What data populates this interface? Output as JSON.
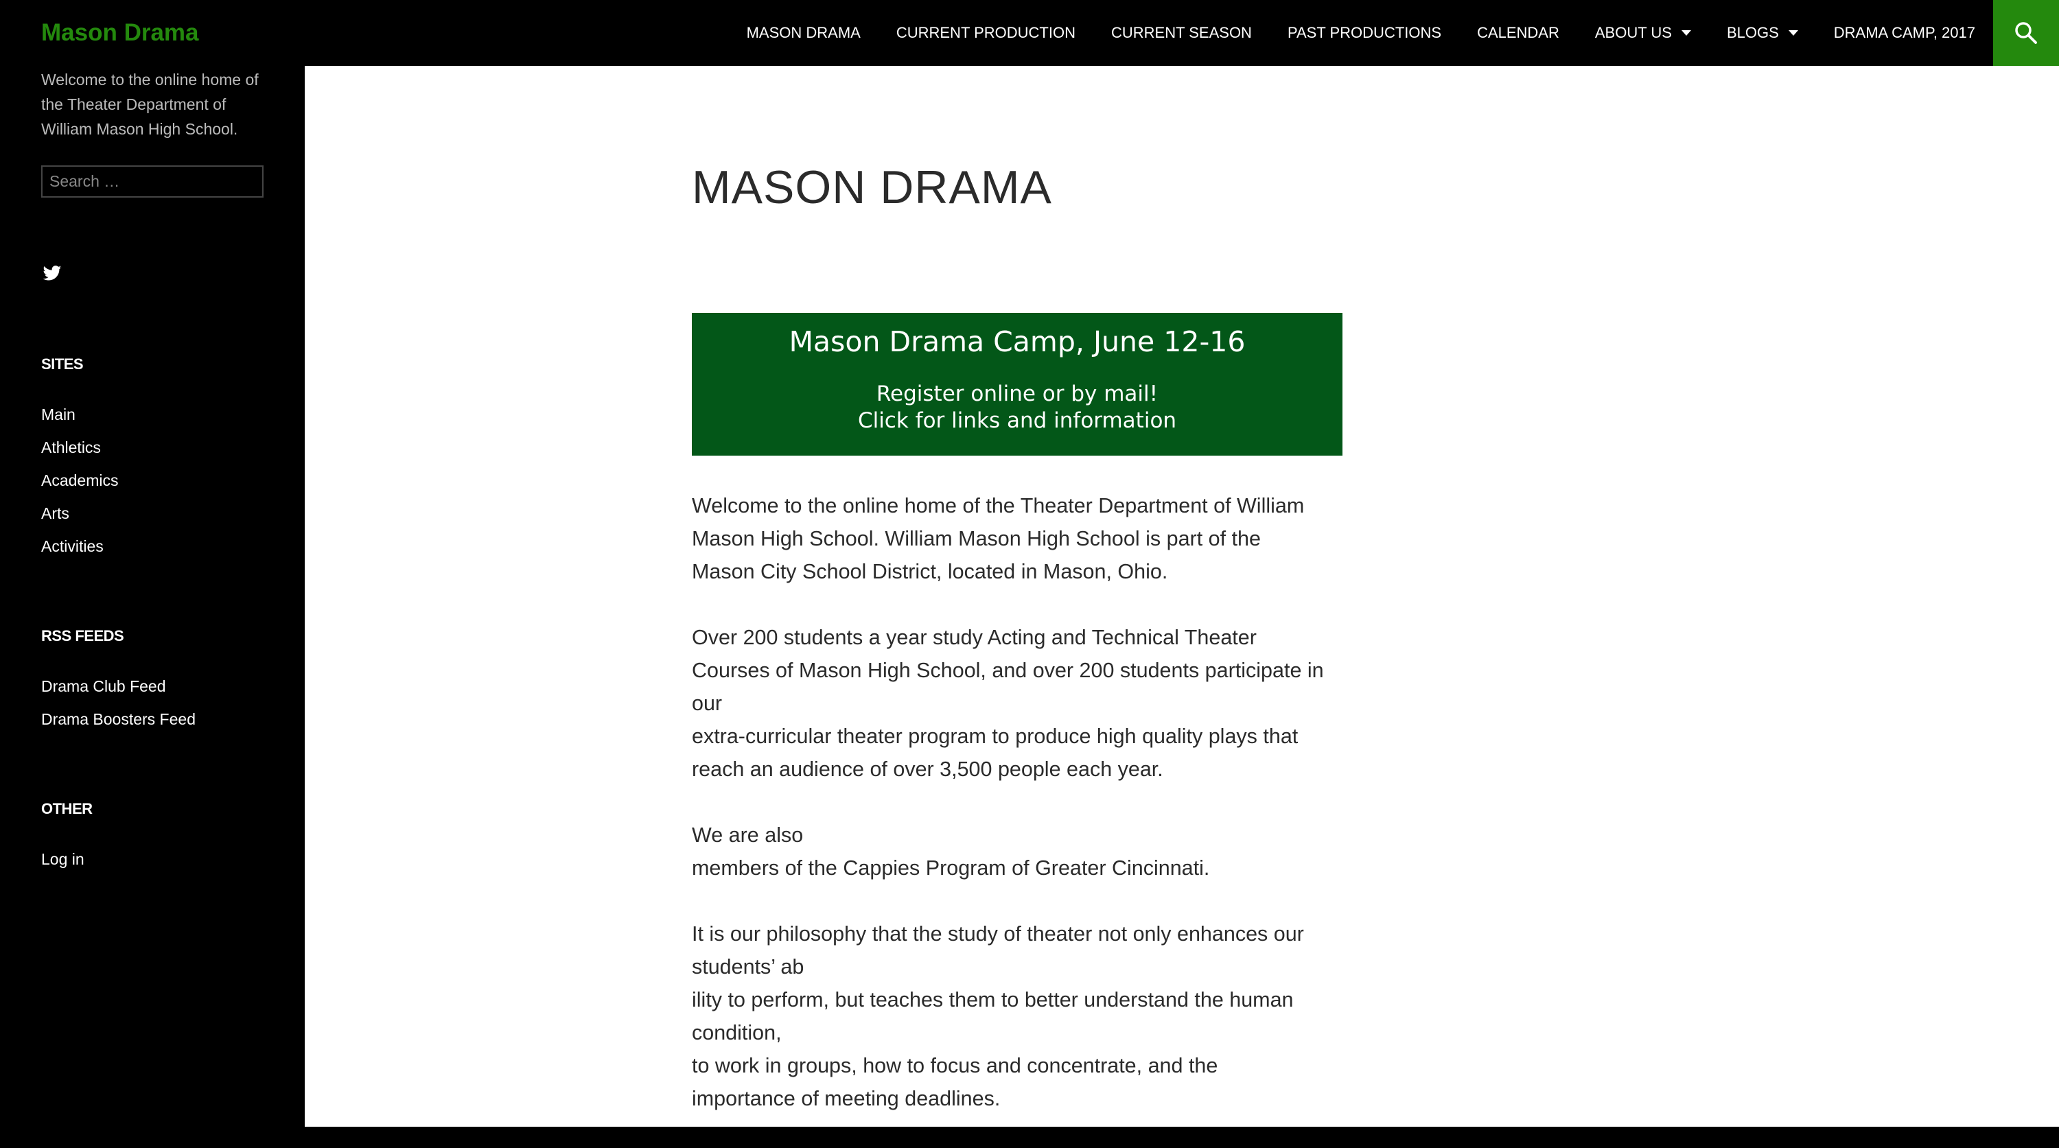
{
  "header": {
    "site_title": "Mason Drama",
    "nav": [
      {
        "label": "MASON DRAMA",
        "active": true,
        "dropdown": false
      },
      {
        "label": "CURRENT PRODUCTION",
        "active": false,
        "dropdown": false
      },
      {
        "label": "CURRENT SEASON",
        "active": false,
        "dropdown": false
      },
      {
        "label": "PAST PRODUCTIONS",
        "active": false,
        "dropdown": false
      },
      {
        "label": "CALENDAR",
        "active": false,
        "dropdown": false
      },
      {
        "label": "ABOUT US",
        "active": false,
        "dropdown": true
      },
      {
        "label": "BLOGS",
        "active": false,
        "dropdown": true
      },
      {
        "label": "DRAMA CAMP, 2017",
        "active": false,
        "dropdown": false
      }
    ],
    "search_icon": "search-icon"
  },
  "sidebar": {
    "description": "Welcome to the online home of the Theater Department of William Mason High School.",
    "search_placeholder": "Search …",
    "social_icon": "twitter-icon",
    "sites": {
      "title": "SITES",
      "items": [
        "Main",
        "Athletics",
        "Academics",
        "Arts",
        "Activities"
      ]
    },
    "rss": {
      "title": "RSS FEEDS",
      "items": [
        "Drama Club Feed",
        "Drama Boosters Feed"
      ]
    },
    "other": {
      "title": "OTHER",
      "items": [
        "Log in"
      ]
    }
  },
  "main": {
    "title": "MASON DRAMA",
    "banner": {
      "title": "Mason Drama Camp, June 12-16",
      "line1": "Register online or by mail!",
      "line2": "Click for links and information"
    },
    "paragraphs": [
      [
        "Welcome to the online home of the Theater Department of William",
        "Mason High School.  William Mason High School is part of the",
        "Mason City School District, located in Mason, Ohio."
      ],
      [
        "Over 200 students a year study Acting and Technical Theater",
        "Courses of Mason High School, and over 200 students participate in",
        "our",
        "extra-curricular theater program to produce high quality plays that",
        "reach an audience of over 3,500 people each year."
      ],
      [
        "We are also",
        "members of the Cappies Program of Greater Cincinnati."
      ],
      [
        "It is our philosophy that the study of theater not only enhances our",
        "students’ ab",
        "ility to perform, but teaches them to better understand the human",
        "condition,",
        "to work in groups, how to focus and concentrate, and the",
        "importance of meeting deadlines."
      ]
    ]
  },
  "colors": {
    "accent": "#24890d",
    "banner": "#035718",
    "background_dark": "#000000"
  }
}
